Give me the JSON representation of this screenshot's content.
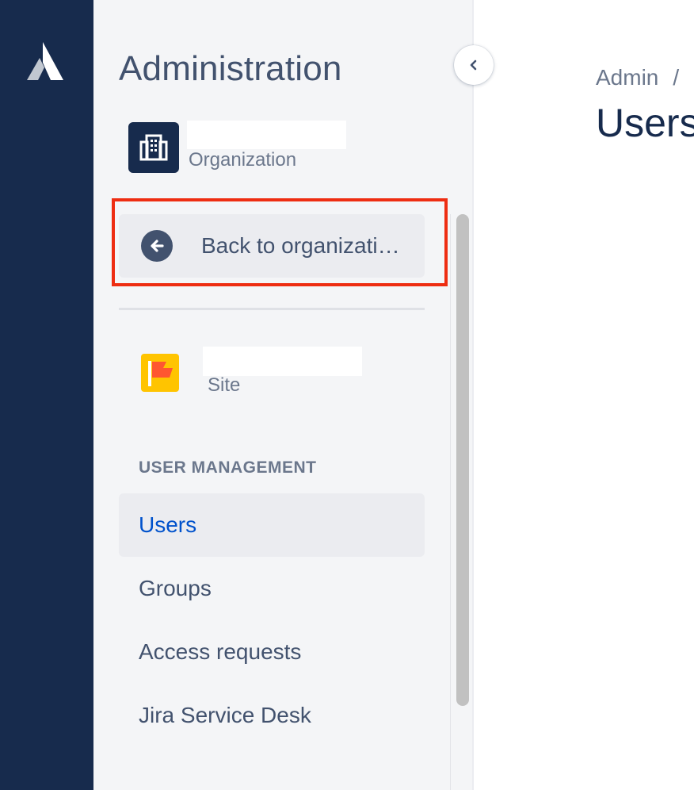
{
  "sidebar": {
    "title": "Administration",
    "organization": {
      "caption": "Organization",
      "icon": "office-building-icon"
    },
    "back_button": {
      "label": "Back to organizati…",
      "icon": "arrow-left-circle-icon"
    },
    "site": {
      "caption": "Site",
      "icon": "flag-icon"
    },
    "section_heading": "USER MANAGEMENT",
    "items": [
      {
        "label": "Users",
        "active": true
      },
      {
        "label": "Groups",
        "active": false
      },
      {
        "label": "Access requests",
        "active": false
      },
      {
        "label": "Jira Service Desk",
        "active": false
      }
    ]
  },
  "header": {
    "breadcrumb": [
      "Admin",
      "/"
    ],
    "title": "Users"
  },
  "colors": {
    "rail": "#172b4d",
    "sidebar_bg": "#f4f5f7",
    "active_text": "#0052cc",
    "highlight_border": "#ee2d12",
    "site_icon": "#ffc400"
  }
}
